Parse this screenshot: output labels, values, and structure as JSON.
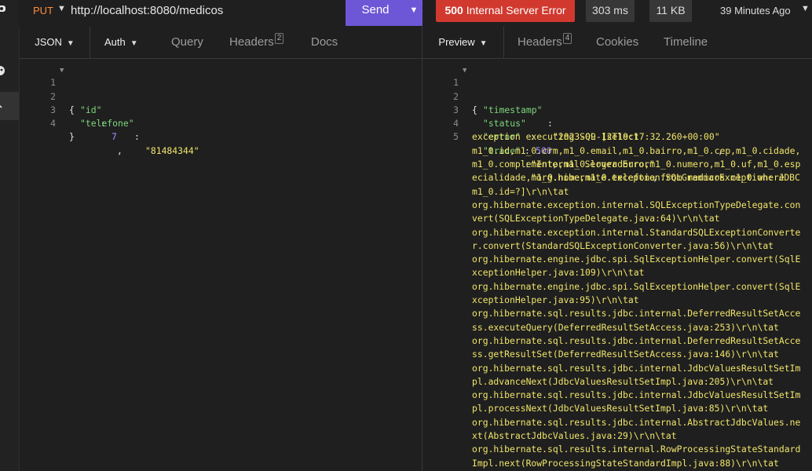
{
  "request": {
    "method": "PUT",
    "url": "http://localhost:8080/medicos",
    "send_label": "Send"
  },
  "response_meta": {
    "status": "500",
    "status_text": "Internal Server Error",
    "time": "303 ms",
    "size": "11 KB",
    "time_ago": "39 Minutes Ago"
  },
  "request_tabs": {
    "body": "JSON",
    "auth": "Auth",
    "query": "Query",
    "headers": "Headers",
    "headers_count": "2",
    "docs": "Docs"
  },
  "response_tabs": {
    "preview": "Preview",
    "headers": "Headers",
    "headers_count": "4",
    "cookies": "Cookies",
    "timeline": "Timeline"
  },
  "request_body": {
    "line_numbers": [
      "1",
      "2",
      "3",
      "4"
    ],
    "open_brace": "{",
    "id_key": "\"id\"",
    "id_value": "7",
    "telefone_key": "\"telefone\"",
    "telefone_value": "\"81484344\"",
    "close_brace": "}"
  },
  "response_body": {
    "line_numbers": [
      "1",
      "2",
      "3",
      "4",
      "5"
    ],
    "open_brace": "{",
    "timestamp_key": "\"timestamp\"",
    "timestamp_value": "\"2023-09-12T19:17:32.260+00:00\"",
    "status_key": "\"status\"",
    "status_value": "500",
    "error_key": "\"error\"",
    "error_value": "\"Internal Server Error\"",
    "trace_key": "\"trace\"",
    "trace_first": "\"org.hibernate.exception.SQLGrammarException: JDBC",
    "trace_lines": [
      "exception executing SQL [select",
      "m1_0.id,m1_0.crm,m1_0.email,m1_0.bairro,m1_0.cep,m1_0.cidade,",
      "m1_0.complemento,m1_0.logradouro,m1_0.numero,m1_0.uf,m1_0.esp",
      "ecialidade,m1_0.nome,m1_0.telefone from medicos m1_0 where",
      "m1_0.id=?]\\r\\n\\tat",
      "org.hibernate.exception.internal.SQLExceptionTypeDelegate.con",
      "vert(SQLExceptionTypeDelegate.java:64)\\r\\n\\tat",
      "org.hibernate.exception.internal.StandardSQLExceptionConverte",
      "r.convert(StandardSQLExceptionConverter.java:56)\\r\\n\\tat",
      "org.hibernate.engine.jdbc.spi.SqlExceptionHelper.convert(SqlE",
      "xceptionHelper.java:109)\\r\\n\\tat",
      "org.hibernate.engine.jdbc.spi.SqlExceptionHelper.convert(SqlE",
      "xceptionHelper.java:95)\\r\\n\\tat",
      "org.hibernate.sql.results.jdbc.internal.DeferredResultSetAcce",
      "ss.executeQuery(DeferredResultSetAccess.java:253)\\r\\n\\tat",
      "org.hibernate.sql.results.jdbc.internal.DeferredResultSetAcce",
      "ss.getResultSet(DeferredResultSetAccess.java:146)\\r\\n\\tat",
      "org.hibernate.sql.results.jdbc.internal.JdbcValuesResultSetIm",
      "pl.advanceNext(JdbcValuesResultSetImpl.java:205)\\r\\n\\tat",
      "org.hibernate.sql.results.jdbc.internal.JdbcValuesResultSetIm",
      "pl.processNext(JdbcValuesResultSetImpl.java:85)\\r\\n\\tat",
      "org.hibernate.sql.results.jdbc.internal.AbstractJdbcValues.ne",
      "xt(AbstractJdbcValues.java:29)\\r\\n\\tat",
      "org.hibernate.sql.results.internal.RowProcessingStateStandard",
      "Impl.next(RowProcessingStateStandardImpl.java:88)\\r\\n\\tat"
    ]
  },
  "icons": {
    "gear": "gear-icon",
    "cookie": "cookie-icon",
    "caret": "chevron-down-icon"
  },
  "colors": {
    "send": "#6e57d6",
    "error": "#d1392f",
    "method": "#ff8c3a",
    "json_key": "#7dd67d",
    "json_string": "#f0e56a",
    "json_number": "#a98bff"
  }
}
